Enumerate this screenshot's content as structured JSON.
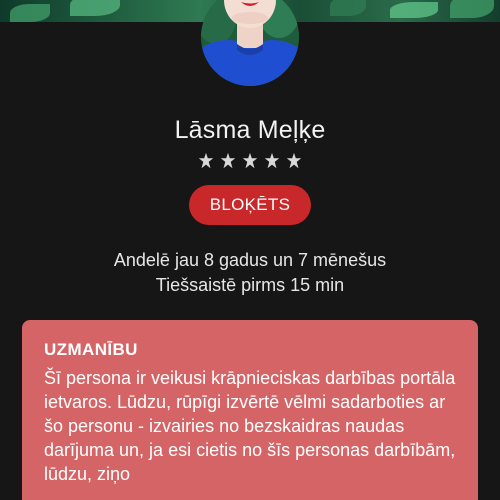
{
  "profile": {
    "name": "Lāsma Meļķe",
    "rating_stars": 5,
    "status_badge": "BLOĶĒTS",
    "membership": "Andelē jau 8 gadus un 7 mēnešus",
    "last_online": "Tiešsaistē pirms 15 min"
  },
  "warning": {
    "title": "UZMANĪBU",
    "body": "Šī persona ir veikusi krāpnieciskas darbības portāla ietvaros. Lūdzu, rūpīgi izvērtē vēlmi sadarboties ar šo personu - izvairies no bezskaidras naudas darījuma un, ja esi cietis no šīs personas darbībām, lūdzu, ziņo"
  },
  "icons": {
    "star": "star-icon"
  },
  "colors": {
    "background": "#111111",
    "badge": "#c9282b",
    "warning": "#d46466",
    "star": "#d8d8d8"
  }
}
